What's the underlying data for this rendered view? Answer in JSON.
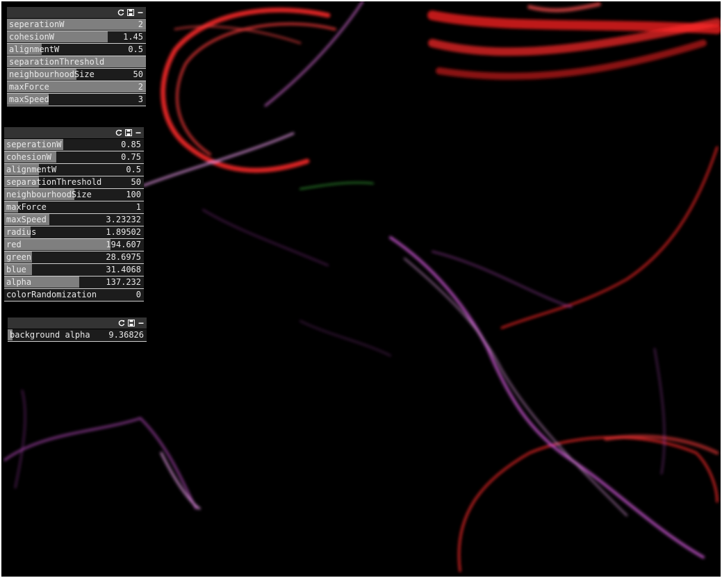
{
  "panel1": {
    "rows": [
      {
        "label": "seperationW",
        "value": "2",
        "fill": 1.0
      },
      {
        "label": "cohesionW",
        "value": "1.45",
        "fill": 0.725
      },
      {
        "label": "alignmentW",
        "value": "0.5",
        "fill": 0.25
      },
      {
        "label": "separationThreshold",
        "value": "",
        "fill": 1.0
      },
      {
        "label": "neighbourhoodSize",
        "value": "50",
        "fill": 0.5
      },
      {
        "label": "maxForce",
        "value": "2",
        "fill": 1.0
      },
      {
        "label": "maxSpeed",
        "value": "3",
        "fill": 0.3
      }
    ]
  },
  "panel2": {
    "rows": [
      {
        "label": "seperationW",
        "value": "0.85",
        "fill": 0.425
      },
      {
        "label": "cohesionW",
        "value": "0.75",
        "fill": 0.375
      },
      {
        "label": "alignmentW",
        "value": "0.5",
        "fill": 0.25
      },
      {
        "label": "separationThreshold",
        "value": "50",
        "fill": 0.25
      },
      {
        "label": "neighbourhoodSize",
        "value": "100",
        "fill": 0.5
      },
      {
        "label": "maxForce",
        "value": "1",
        "fill": 0.1
      },
      {
        "label": "maxSpeed",
        "value": "3.23232",
        "fill": 0.323
      },
      {
        "label": "radius",
        "value": "1.89502",
        "fill": 0.19
      },
      {
        "label": "red",
        "value": "194.607",
        "fill": 0.763
      },
      {
        "label": "green",
        "value": "28.6975",
        "fill": 0.2
      },
      {
        "label": "blue",
        "value": "31.4068",
        "fill": 0.2
      },
      {
        "label": "alpha",
        "value": "137.232",
        "fill": 0.538
      },
      {
        "label": "colorRandomization",
        "value": "0",
        "fill": 0.0
      }
    ]
  },
  "panel3": {
    "rows": [
      {
        "label": "background alpha",
        "value": "9.36826",
        "fill": 0.037
      }
    ]
  },
  "icons": {
    "reset": "reset-icon",
    "save": "save-icon",
    "minimize": "minimize-icon"
  },
  "colors": {
    "trail_red": "#ff2a2a",
    "trail_magenta": "#d85ce0",
    "trail_pink": "#f0a0f0",
    "background": "#000000",
    "slider_fill": "#7f7f7f"
  }
}
